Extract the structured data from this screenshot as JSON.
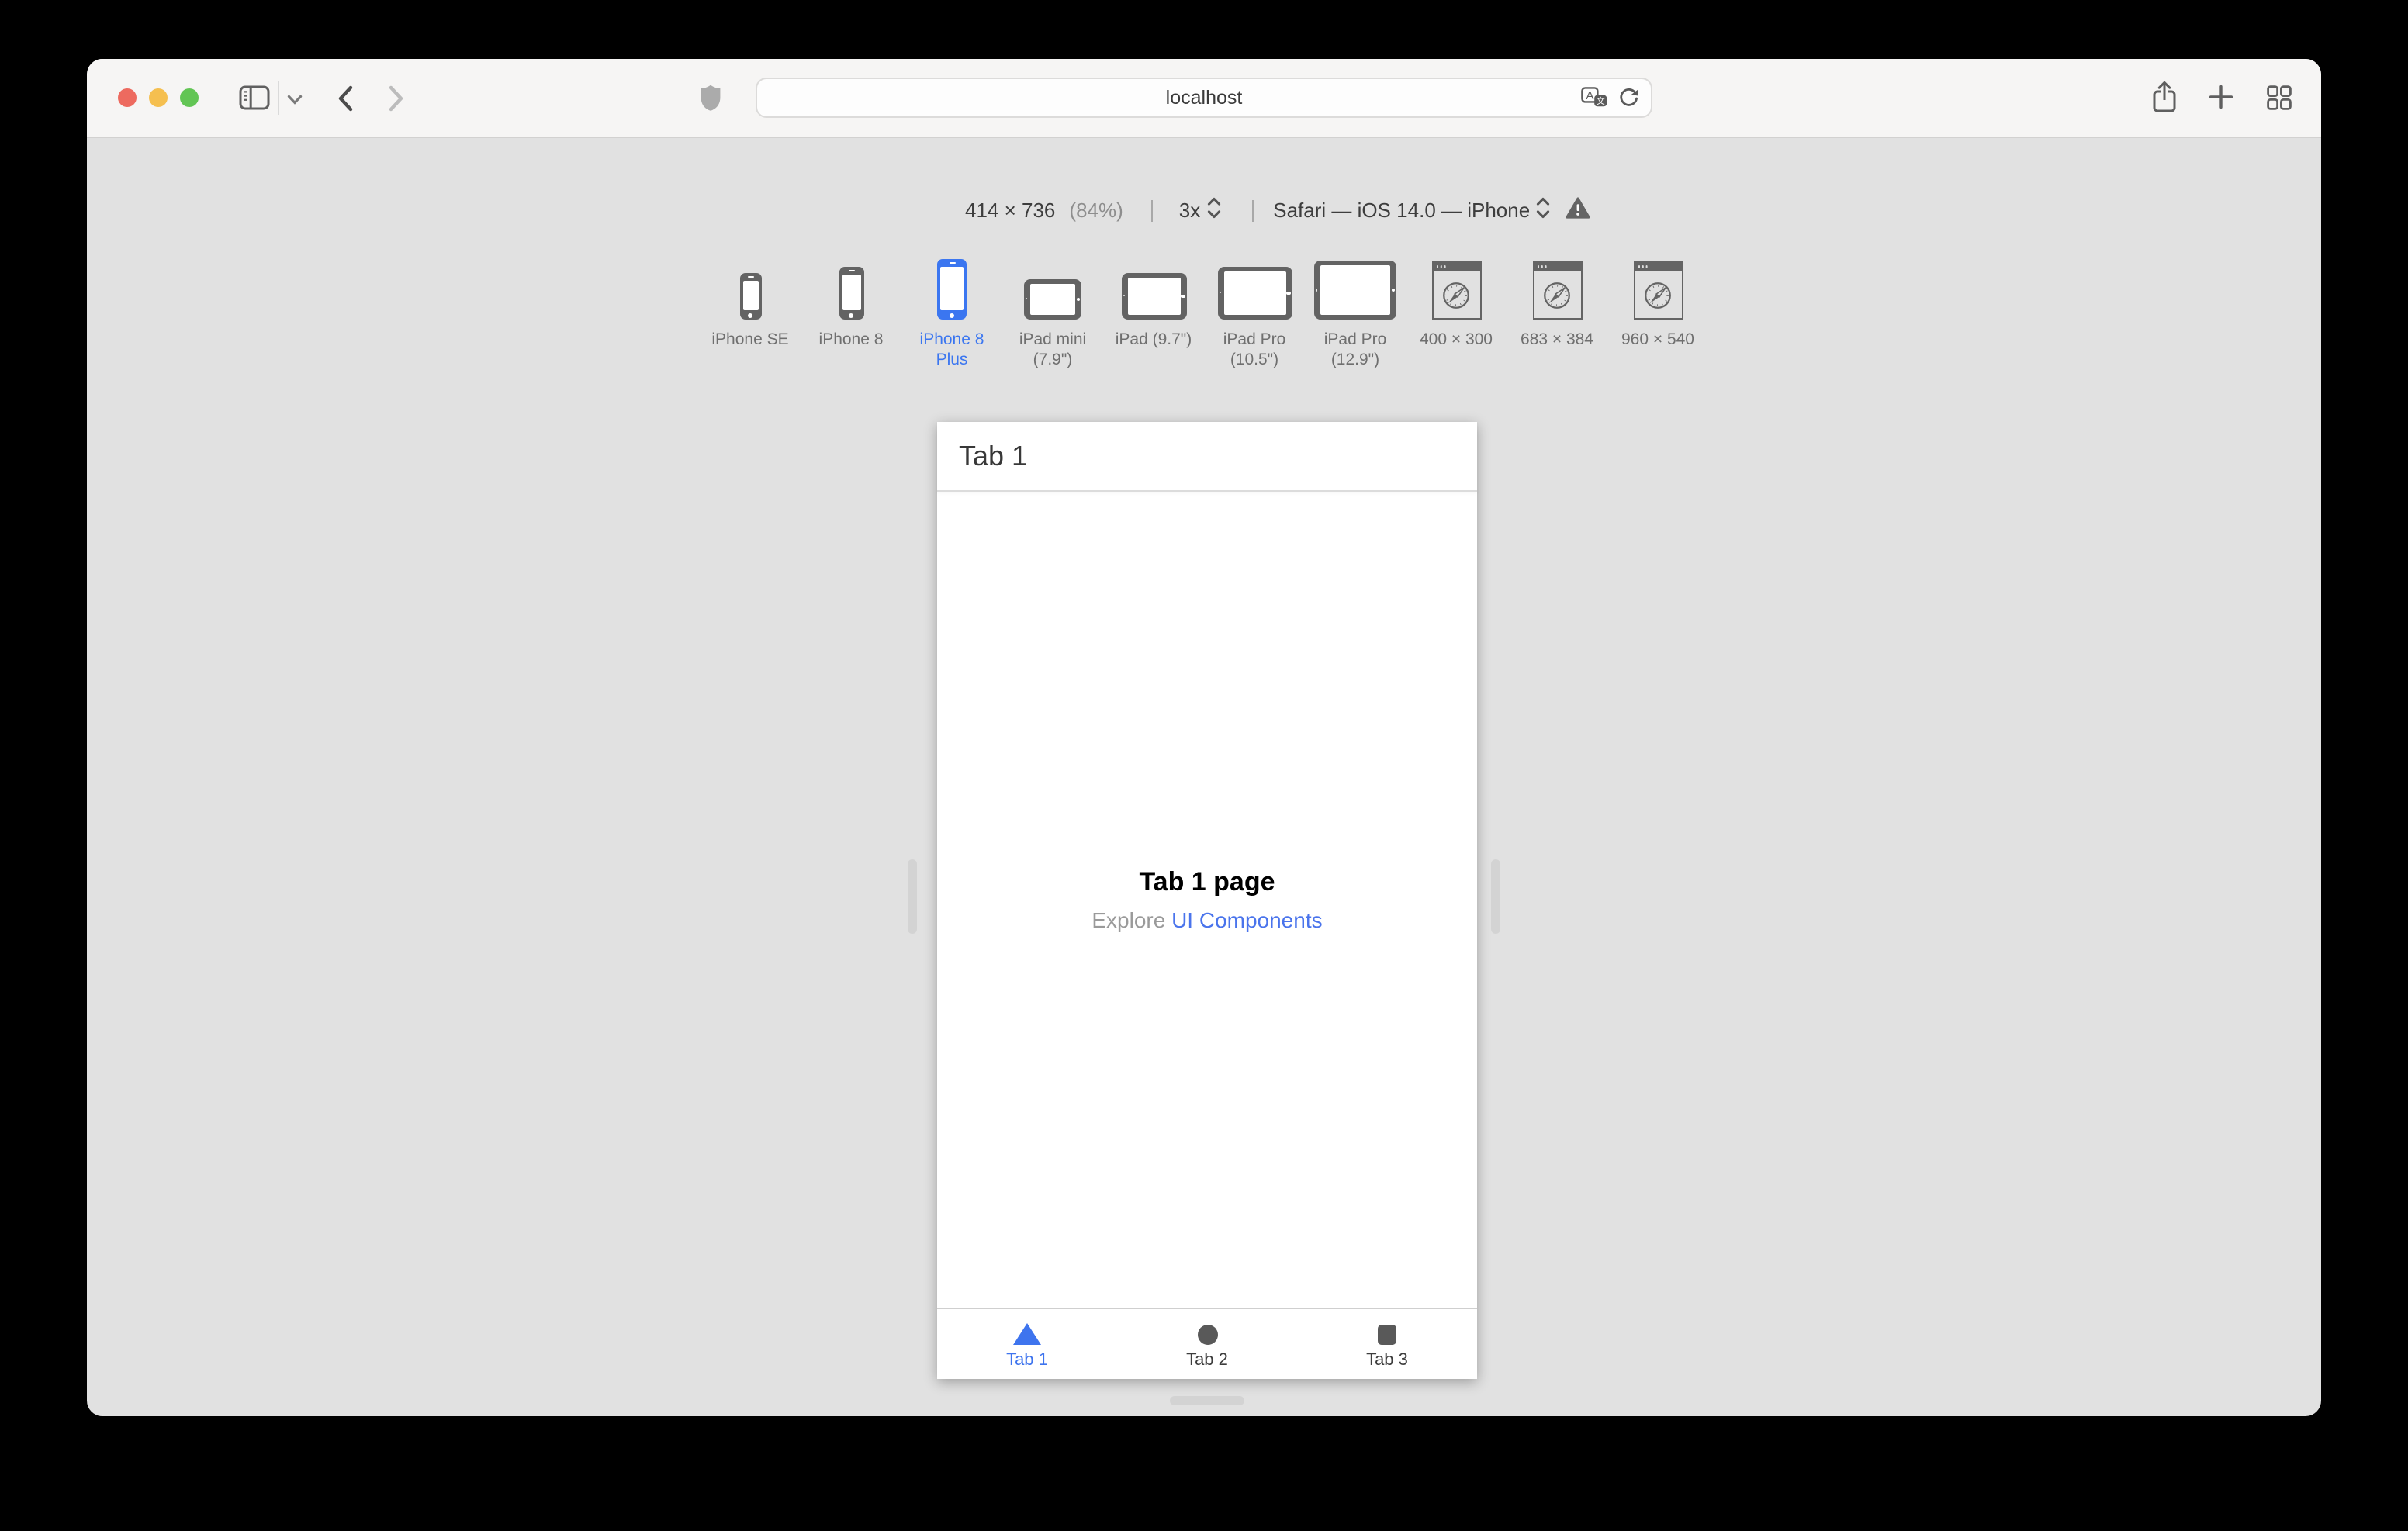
{
  "browser": {
    "url": "localhost"
  },
  "rdm_bar": {
    "dimensions": "414 × 736",
    "zoom_percent": "(84%)",
    "pixel_ratio": "3x",
    "user_agent": "Safari — iOS 14.0 — iPhone"
  },
  "devices": {
    "items": [
      {
        "label": "iPhone SE",
        "selected": false
      },
      {
        "label": "iPhone 8",
        "selected": false
      },
      {
        "label": "iPhone 8 Plus",
        "selected": true
      },
      {
        "label": "iPad mini (7.9\")",
        "selected": false
      },
      {
        "label": "iPad (9.7\")",
        "selected": false
      },
      {
        "label": "iPad Pro (10.5\")",
        "selected": false
      },
      {
        "label": "iPad Pro (12.9\")",
        "selected": false
      },
      {
        "label": "400 × 300",
        "selected": false
      },
      {
        "label": "683 × 384",
        "selected": false
      },
      {
        "label": "960 × 540",
        "selected": false
      }
    ]
  },
  "app": {
    "navbar_title": "Tab 1",
    "page_title": "Tab 1 page",
    "subtitle_text": "Explore ",
    "subtitle_link": "UI Components",
    "tabs": [
      {
        "label": "Tab 1",
        "icon": "triangle",
        "active": true
      },
      {
        "label": "Tab 2",
        "icon": "circle",
        "active": false
      },
      {
        "label": "Tab 3",
        "icon": "square",
        "active": false
      }
    ]
  },
  "colors": {
    "accent_blue": "#3e74ee",
    "link_blue": "#4a74ec",
    "traffic_red": "#ed6a5f",
    "traffic_yellow": "#f5bf4f",
    "traffic_green": "#62c554",
    "window_bg": "#e1e1e1",
    "toolbar_bg": "#f6f5f4"
  }
}
